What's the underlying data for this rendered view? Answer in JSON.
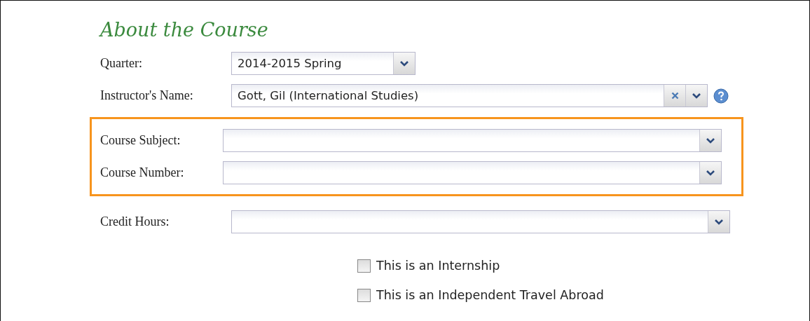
{
  "title": "About the Course",
  "groups": [
    {
      "highlighted": false,
      "fields": [
        {
          "label": "Quarter:",
          "kind": "short",
          "value": "2014-2015 Spring",
          "help": false
        },
        {
          "label": "Instructor's Name:",
          "kind": "combo",
          "value": "Gott, Gil (International Studies)",
          "help": true
        }
      ]
    },
    {
      "highlighted": true,
      "fields": [
        {
          "label": "Course Subject:",
          "kind": "full",
          "help": false
        },
        {
          "label": "Course Number:",
          "kind": "full",
          "help": false
        }
      ]
    },
    {
      "highlighted": false,
      "fields": [
        {
          "label": "Credit Hours:",
          "kind": "full",
          "help": false
        }
      ]
    }
  ],
  "checkboxes": [
    {
      "label": "This is an Internship",
      "checked": false
    },
    {
      "label": "This is an Independent Travel Abroad",
      "checked": false
    }
  ]
}
